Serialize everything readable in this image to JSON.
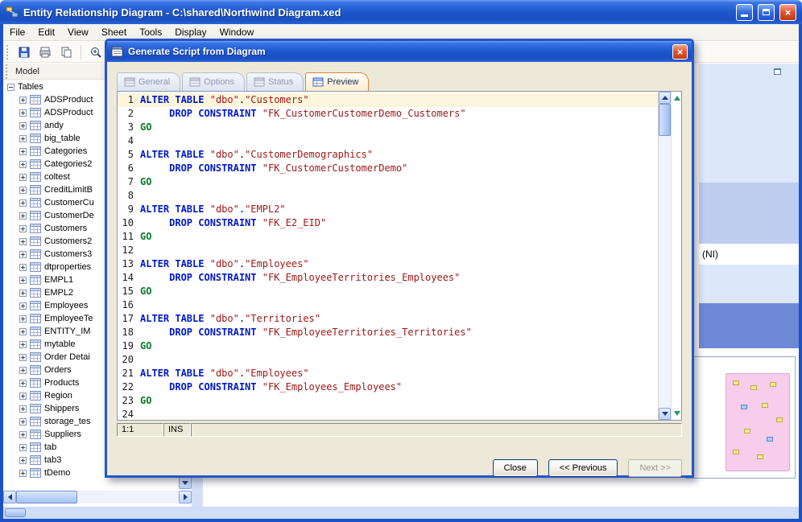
{
  "icons": {
    "close": "×"
  },
  "window": {
    "title": "Entity Relationship Diagram - C:\\shared\\Northwind Diagram.xed",
    "menus": [
      "File",
      "Edit",
      "View",
      "Sheet",
      "Tools",
      "Display",
      "Window"
    ]
  },
  "sidebar": {
    "panel_title": "Model",
    "root_label": "Tables",
    "items": [
      "ADSProduct",
      "ADSProduct",
      "andy",
      "big_table",
      "Categories",
      "Categories2",
      "coltest",
      "CreditLimitB",
      "CustomerCu",
      "CustomerDe",
      "Customers",
      "Customers2",
      "Customers3",
      "dtproperties",
      "EMPL1",
      "EMPL2",
      "Employees",
      "EmployeeTe",
      "ENTITY_IM",
      "mytable",
      "Order Detai",
      "Orders",
      "Products",
      "Region",
      "Shippers",
      "storage_tes",
      "Suppliers",
      "tab",
      "tab3",
      "tDemo"
    ]
  },
  "background": {
    "ni_label": "(NI)"
  },
  "dialog": {
    "title": "Generate Script from Diagram",
    "tabs": [
      {
        "label": "General",
        "active": false
      },
      {
        "label": "Options",
        "active": false
      },
      {
        "label": "Status",
        "active": false
      },
      {
        "label": "Preview",
        "active": true
      }
    ],
    "editor": {
      "active_line": 1,
      "status_position": "1:1",
      "status_mode": "INS",
      "lines": [
        [
          [
            "k",
            "ALTER TABLE"
          ],
          [
            "p",
            " "
          ],
          [
            "s",
            "\"dbo\""
          ],
          [
            "p",
            "."
          ],
          [
            "s",
            "\"Customers\""
          ]
        ],
        [
          [
            "p",
            "     "
          ],
          [
            "k",
            "DROP CONSTRAINT"
          ],
          [
            "p",
            " "
          ],
          [
            "s",
            "\"FK_CustomerCustomerDemo_Customers\""
          ]
        ],
        [
          [
            "g",
            "GO"
          ]
        ],
        [],
        [
          [
            "k",
            "ALTER TABLE"
          ],
          [
            "p",
            " "
          ],
          [
            "s",
            "\"dbo\""
          ],
          [
            "p",
            "."
          ],
          [
            "s",
            "\"CustomerDemographics\""
          ]
        ],
        [
          [
            "p",
            "     "
          ],
          [
            "k",
            "DROP CONSTRAINT"
          ],
          [
            "p",
            " "
          ],
          [
            "s",
            "\"FK_CustomerCustomerDemo\""
          ]
        ],
        [
          [
            "g",
            "GO"
          ]
        ],
        [],
        [
          [
            "k",
            "ALTER TABLE"
          ],
          [
            "p",
            " "
          ],
          [
            "s",
            "\"dbo\""
          ],
          [
            "p",
            "."
          ],
          [
            "s",
            "\"EMPL2\""
          ]
        ],
        [
          [
            "p",
            "     "
          ],
          [
            "k",
            "DROP CONSTRAINT"
          ],
          [
            "p",
            " "
          ],
          [
            "s",
            "\"FK_E2_EID\""
          ]
        ],
        [
          [
            "g",
            "GO"
          ]
        ],
        [],
        [
          [
            "k",
            "ALTER TABLE"
          ],
          [
            "p",
            " "
          ],
          [
            "s",
            "\"dbo\""
          ],
          [
            "p",
            "."
          ],
          [
            "s",
            "\"Employees\""
          ]
        ],
        [
          [
            "p",
            "     "
          ],
          [
            "k",
            "DROP CONSTRAINT"
          ],
          [
            "p",
            " "
          ],
          [
            "s",
            "\"FK_EmployeeTerritories_Employees\""
          ]
        ],
        [
          [
            "g",
            "GO"
          ]
        ],
        [],
        [
          [
            "k",
            "ALTER TABLE"
          ],
          [
            "p",
            " "
          ],
          [
            "s",
            "\"dbo\""
          ],
          [
            "p",
            "."
          ],
          [
            "s",
            "\"Territories\""
          ]
        ],
        [
          [
            "p",
            "     "
          ],
          [
            "k",
            "DROP CONSTRAINT"
          ],
          [
            "p",
            " "
          ],
          [
            "s",
            "\"FK_EmployeeTerritories_Territories\""
          ]
        ],
        [
          [
            "g",
            "GO"
          ]
        ],
        [],
        [
          [
            "k",
            "ALTER TABLE"
          ],
          [
            "p",
            " "
          ],
          [
            "s",
            "\"dbo\""
          ],
          [
            "p",
            "."
          ],
          [
            "s",
            "\"Employees\""
          ]
        ],
        [
          [
            "p",
            "     "
          ],
          [
            "k",
            "DROP CONSTRAINT"
          ],
          [
            "p",
            " "
          ],
          [
            "s",
            "\"FK_Employees_Employees\""
          ]
        ],
        [
          [
            "g",
            "GO"
          ]
        ],
        []
      ]
    },
    "buttons": [
      {
        "name": "close-button",
        "label": "Close",
        "disabled": false
      },
      {
        "name": "previous-button",
        "label": "<< Previous",
        "disabled": false
      },
      {
        "name": "next-button",
        "label": "Next >>",
        "disabled": true
      }
    ]
  }
}
